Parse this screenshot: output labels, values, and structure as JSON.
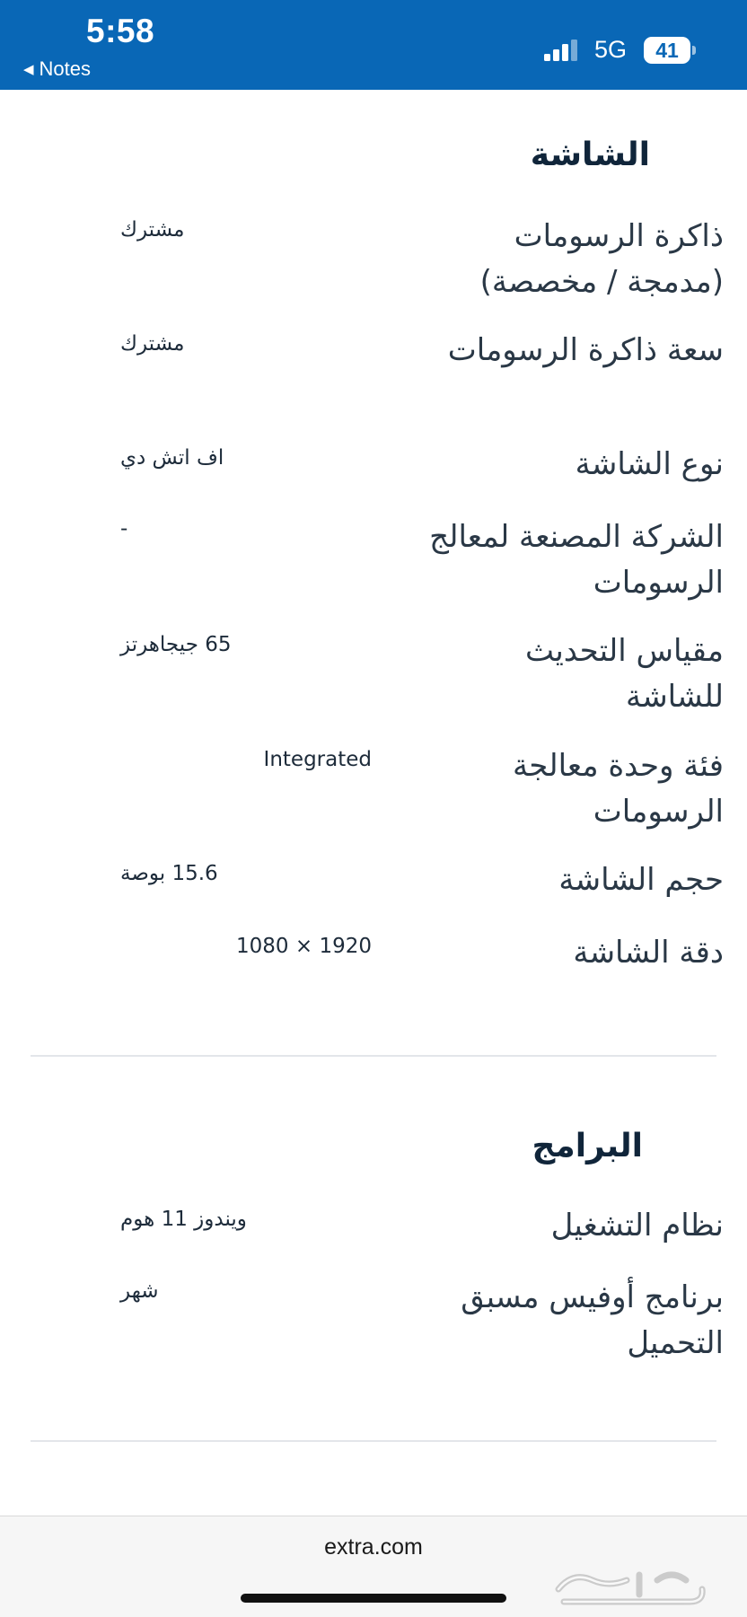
{
  "status_bar": {
    "time": "5:58",
    "back_label": "Notes",
    "network": "5G",
    "battery": "41"
  },
  "display_section": {
    "title": "الشاشة",
    "rows": [
      {
        "label": "ذاكرة الرسومات (مدمجة / مخصصة)",
        "value": "مشترك"
      },
      {
        "label": "سعة ذاكرة الرسومات",
        "value": "مشترك"
      },
      {
        "label": "نوع الشاشة",
        "value": "اف اتش دي"
      },
      {
        "label": "الشركة المصنعة لمعالج الرسومات",
        "value": "-"
      },
      {
        "label": "مقياس التحديث للشاشة",
        "value": "65 جيجاهرتز"
      },
      {
        "label": "فئة وحدة معالجة الرسومات",
        "value": "Integrated"
      },
      {
        "label": "حجم الشاشة",
        "value": "15.6 بوصة"
      },
      {
        "label": "دقة الشاشة",
        "value": "1080 × 1920"
      }
    ]
  },
  "software_section": {
    "title": "البرامج",
    "rows": [
      {
        "label": "نظام التشغيل",
        "value": "ويندوز 11 هوم"
      },
      {
        "label": "برنامج أوفيس مسبق التحميل",
        "value": "شهر"
      }
    ]
  },
  "browser": {
    "url": "extra.com"
  },
  "watermark": {
    "text": "حراج"
  }
}
